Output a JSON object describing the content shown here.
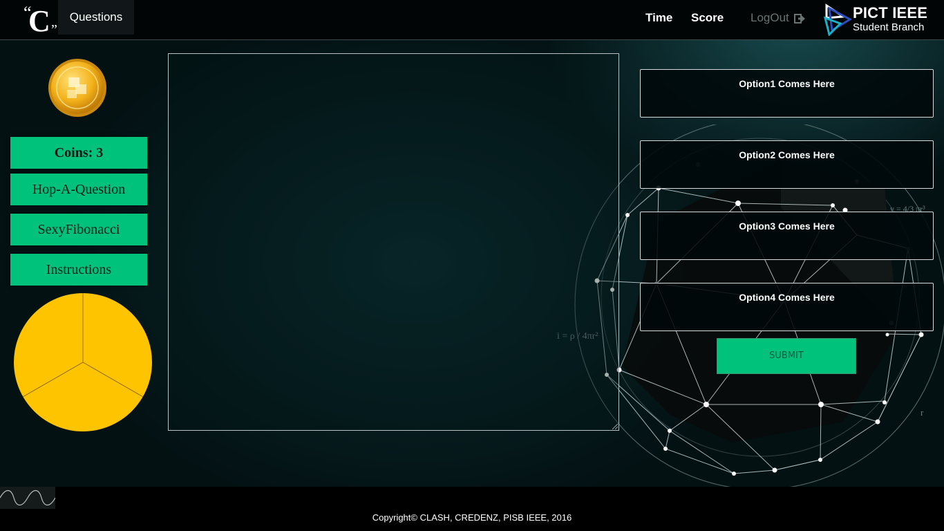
{
  "header": {
    "logo_quote_open": "“",
    "logo_letter": "C",
    "logo_quote_close": "”",
    "nav_questions": "Questions",
    "time_label": "Time",
    "score_label": "Score",
    "logout_label": "LogOut",
    "logout_icon": "logout-icon",
    "branch_logo_icon": "pict-ieee-logo-icon",
    "branch_title": "PICT IEEE",
    "branch_subtitle": "Student Branch"
  },
  "sidebar": {
    "coin_icon": "gold-coin-icon",
    "coins_label": "Coins: 3",
    "buttons": [
      "Hop-A-Question",
      "SexyFibonacci",
      "Instructions"
    ],
    "pie_color": "#ffc400",
    "pie_slices": 3
  },
  "question": {
    "text": ""
  },
  "options": [
    "Option1 Comes Here",
    "Option2 Comes Here",
    "Option3 Comes Here",
    "Option4 Comes Here"
  ],
  "submit_label": "SUBMIT",
  "background_formulas": {
    "intensity": "i = ρ / 4πr²",
    "volume": "v = 4/3 πr³",
    "radius": "r"
  },
  "footer": {
    "copyright": "Copyright© CLASH, CREDENZ, PISB IEEE, 2016"
  },
  "colors": {
    "accent_green": "#00c27a",
    "pie_yellow": "#ffc400",
    "background": "#031113"
  }
}
